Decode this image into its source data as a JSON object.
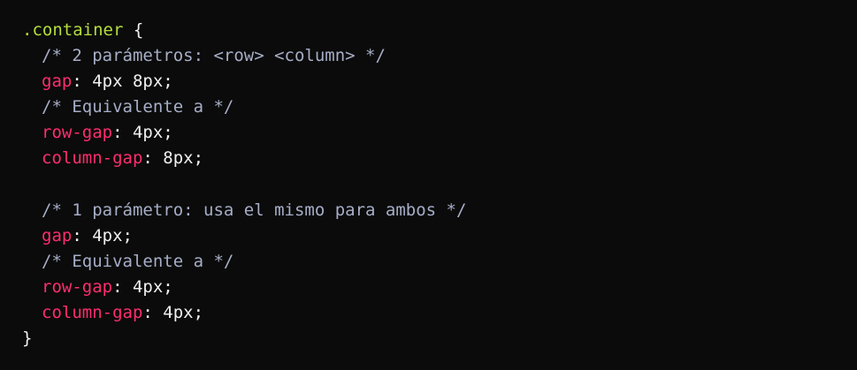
{
  "colors": {
    "background": "#0b0b0b",
    "selector": "#b4dd3c",
    "comment": "#a6aec7",
    "property": "#ff2d6f",
    "text": "#f0f0f0"
  },
  "code": {
    "selector": ".container",
    "open_brace": " {",
    "close_brace": "}",
    "lines": [
      {
        "type": "comment",
        "text": "/* 2 parámetros: <row> <column> */"
      },
      {
        "type": "decl",
        "property": "gap",
        "value": "4px 8px"
      },
      {
        "type": "comment",
        "text": "/* Equivalente a */"
      },
      {
        "type": "decl",
        "property": "row-gap",
        "value": "4px"
      },
      {
        "type": "decl",
        "property": "column-gap",
        "value": "8px"
      },
      {
        "type": "blank"
      },
      {
        "type": "comment",
        "text": "/* 1 parámetro: usa el mismo para ambos */"
      },
      {
        "type": "decl",
        "property": "gap",
        "value": "4px"
      },
      {
        "type": "comment",
        "text": "/* Equivalente a */"
      },
      {
        "type": "decl",
        "property": "row-gap",
        "value": "4px"
      },
      {
        "type": "decl",
        "property": "column-gap",
        "value": "4px"
      }
    ]
  }
}
